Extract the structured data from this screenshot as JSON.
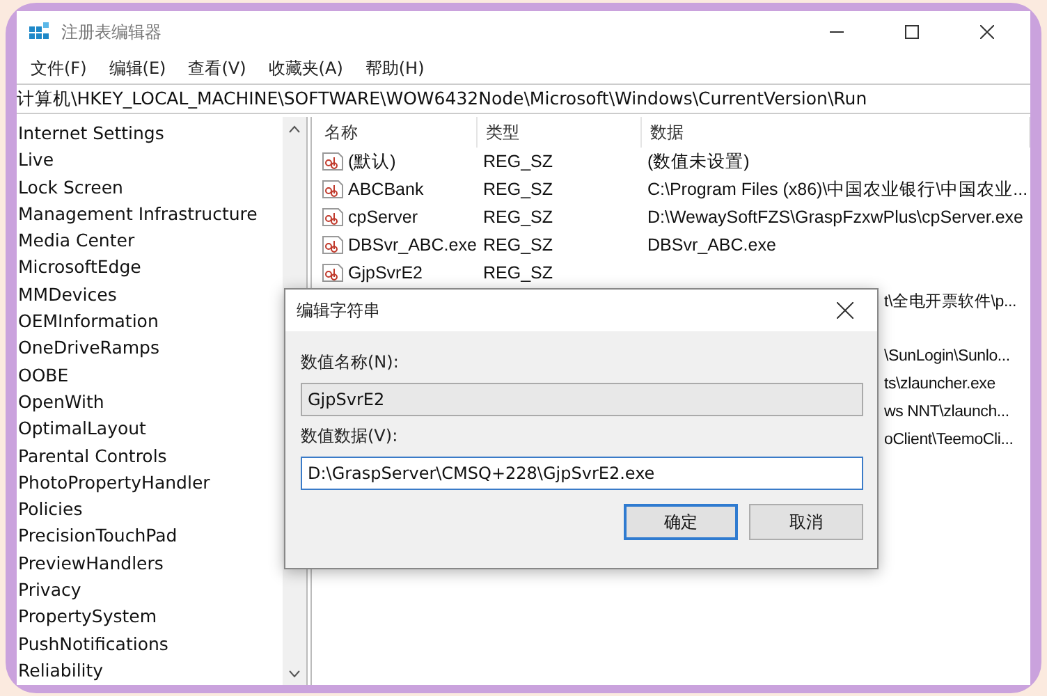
{
  "window": {
    "title": "注册表编辑器"
  },
  "menu": [
    "文件(F)",
    "编辑(E)",
    "查看(V)",
    "收藏夹(A)",
    "帮助(H)"
  ],
  "address": "计算机\\HKEY_LOCAL_MACHINE\\SOFTWARE\\WOW6432Node\\Microsoft\\Windows\\CurrentVersion\\Run",
  "tree": {
    "items": [
      "Internet Settings",
      "Live",
      "Lock Screen",
      "Management Infrastructure",
      "Media Center",
      "MicrosoftEdge",
      "MMDevices",
      "OEMInformation",
      "OneDriveRamps",
      "OOBE",
      "OpenWith",
      "OptimalLayout",
      "Parental Controls",
      "PhotoPropertyHandler",
      "Policies",
      "PrecisionTouchPad",
      "PreviewHandlers",
      "Privacy",
      "PropertySystem",
      "PushNotifications",
      "Reliability"
    ]
  },
  "table": {
    "columns": [
      "名称",
      "类型",
      "数据"
    ],
    "rows": [
      {
        "kind": "full",
        "name": "(默认)",
        "type": "REG_SZ",
        "data": "(数值未设置)"
      },
      {
        "kind": "full",
        "name": "ABCBank",
        "type": "REG_SZ",
        "data": "C:\\Program Files (x86)\\中国农业银行\\中国农业..."
      },
      {
        "kind": "full",
        "name": "cpServer",
        "type": "REG_SZ",
        "data": "D:\\WewaySoftFZS\\GraspFzxwPlus\\cpServer.exe"
      },
      {
        "kind": "full",
        "name": "DBSvr_ABC.exe",
        "type": "REG_SZ",
        "data": "DBSvr_ABC.exe"
      },
      {
        "kind": "full",
        "name": "GjpSvrE2",
        "type": "REG_SZ"
      },
      {
        "kind": "partial",
        "data": "t\\全电开票软件\\p..."
      },
      {
        "kind": "partial"
      },
      {
        "kind": "partial",
        "data": "\\SunLogin\\Sunlo..."
      },
      {
        "kind": "partial",
        "data": "ts\\zlauncher.exe"
      },
      {
        "kind": "partial",
        "data": "ws NNT\\zlaunch..."
      },
      {
        "kind": "partial",
        "data": "oClient\\TeemoCli..."
      }
    ]
  },
  "dialog": {
    "title": "编辑字符串",
    "name_label": "数值名称(N):",
    "name_value": "GjpSvrE2",
    "data_label": "数值数据(V):",
    "data_value": "D:\\GraspServer\\CMSQ+228\\GjpSvrE2.exe",
    "buttons": [
      {
        "label": "确定",
        "default": true
      },
      {
        "label": "取消",
        "default": false
      }
    ]
  }
}
